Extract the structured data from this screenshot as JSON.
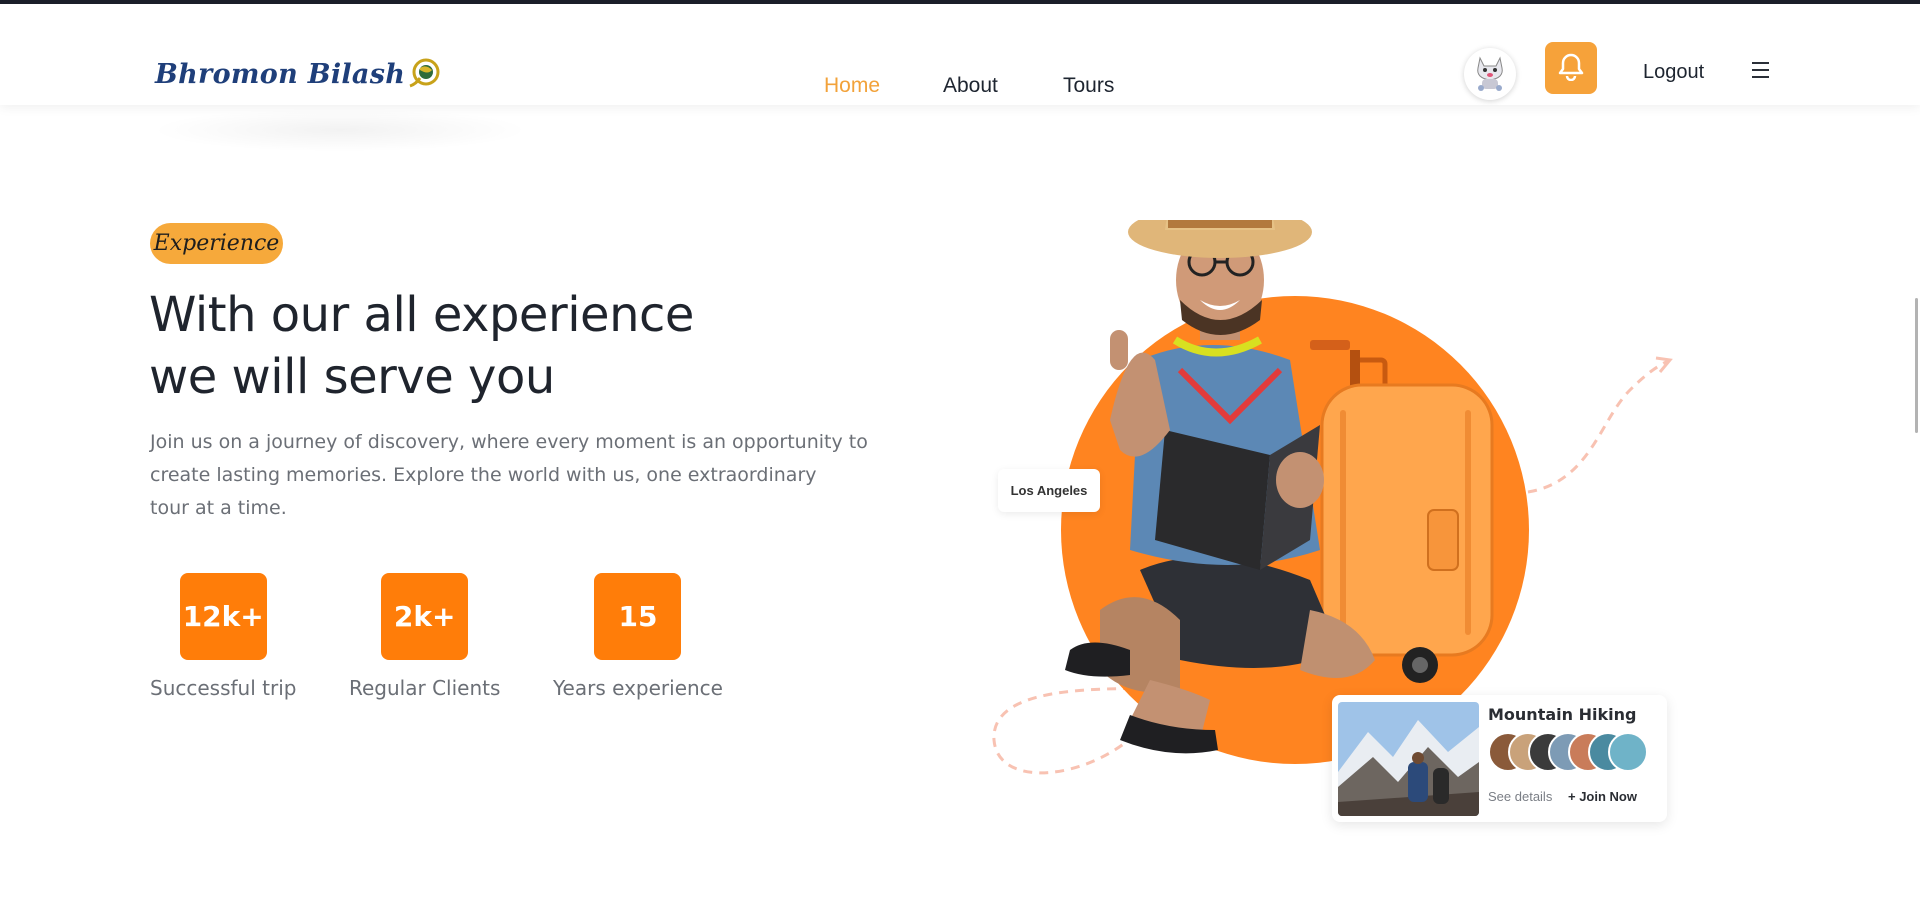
{
  "brand": {
    "logo_text": "Bhromon Bilash",
    "accent": "#f6a23a",
    "orange": "#ff7d09"
  },
  "nav": {
    "items": [
      {
        "label": "Home",
        "active": true
      },
      {
        "label": "About",
        "active": false
      },
      {
        "label": "Tours",
        "active": false
      }
    ]
  },
  "header_actions": {
    "avatar_icon": "cat-avatar-icon",
    "notification_icon": "bell-icon",
    "logout_label": "Logout",
    "menu_icon": "hamburger-icon"
  },
  "hero": {
    "badge": "Experience",
    "title_line1": "With our all experience",
    "title_line2": "we will serve you",
    "description_line1": "Join us on a journey of discovery, where every moment is an opportunity to",
    "description_line2": "create lasting memories. Explore the world with us, one extraordinary",
    "description_line3": "tour at a time.",
    "stats": [
      {
        "value": "12k+",
        "label": "Successful trip"
      },
      {
        "value": "2k+",
        "label": "Regular Clients"
      },
      {
        "value": "15",
        "label": "Years experience"
      }
    ]
  },
  "art": {
    "location_tag": "Los Angeles",
    "card": {
      "title": "Mountain Hiking",
      "see_details": "See details",
      "join": "+ Join Now"
    }
  }
}
